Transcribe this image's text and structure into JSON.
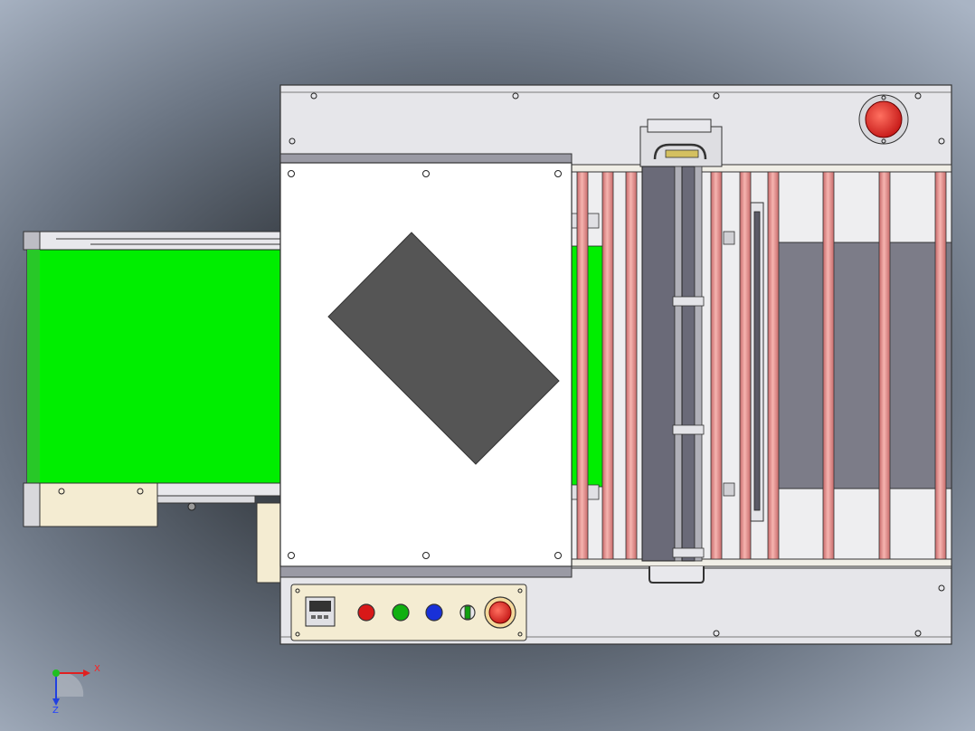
{
  "view": {
    "title": "",
    "colors": {
      "belt": "#00ee00",
      "frame": "#e4e4e8",
      "cover": "#ffffff",
      "roller": "#f0a0a0",
      "slot": "#7a7a88",
      "product": "#555555",
      "panel": "#f4ecd2",
      "estop": "#e02020"
    }
  },
  "control_panel": {
    "display": "display-icon",
    "buttons": [
      {
        "name": "red-button",
        "color": "#d81818"
      },
      {
        "name": "green-button",
        "color": "#10b010"
      },
      {
        "name": "blue-button",
        "color": "#1830d8"
      }
    ],
    "selector": "selector-switch-icon",
    "emergency_stop": "emergency-stop-icon"
  },
  "axis_triad": {
    "x_label": "X",
    "y_label": "Y",
    "z_label": "Z"
  }
}
